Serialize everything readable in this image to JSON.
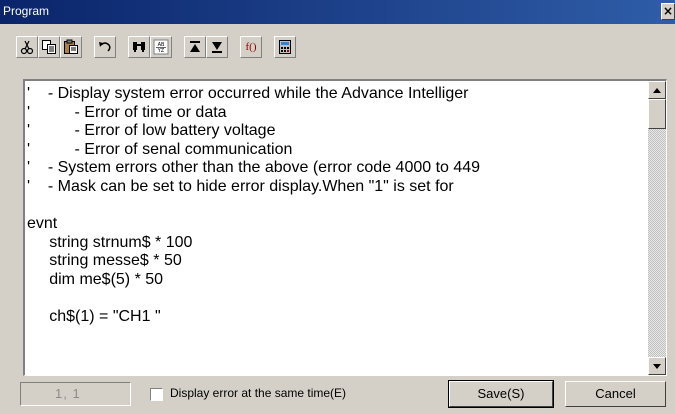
{
  "window": {
    "title": "Program",
    "close_glyph": "×"
  },
  "toolbar": {
    "buttons": [
      {
        "name": "cut-icon",
        "tooltip": ""
      },
      {
        "name": "copy-icon",
        "tooltip": ""
      },
      {
        "name": "paste-icon",
        "tooltip": ""
      },
      {
        "name": "undo-icon",
        "tooltip": ""
      },
      {
        "name": "find-icon",
        "tooltip": ""
      },
      {
        "name": "replace-icon",
        "tooltip": ""
      },
      {
        "name": "go-top-icon",
        "tooltip": ""
      },
      {
        "name": "go-bottom-icon",
        "tooltip": ""
      },
      {
        "name": "function-icon",
        "tooltip": ""
      },
      {
        "name": "calculator-icon",
        "tooltip": ""
      }
    ],
    "function_label": "f()"
  },
  "editor": {
    "lines": [
      "'    - Display system error occurred while the Advance Intelliger",
      "'          - Error of time or data",
      "'          - Error of low battery voltage",
      "'          - Error of senal communication",
      "'    - System errors other than the above (error code 4000 to 449",
      "'    - Mask can be set to hide error display.When \"1\" is set for",
      "",
      "evnt",
      "     string strnum$ * 100",
      "     string messe$ * 50",
      "     dim me$(5) * 50",
      "",
      "     ch$(1) = \"CH1 \""
    ]
  },
  "status": {
    "cursor_position": "1,    1",
    "display_error_checkbox": {
      "label": "Display error at the same time(E)",
      "checked": false
    }
  },
  "buttons": {
    "save_label": "Save(S)",
    "cancel_label": "Cancel"
  }
}
